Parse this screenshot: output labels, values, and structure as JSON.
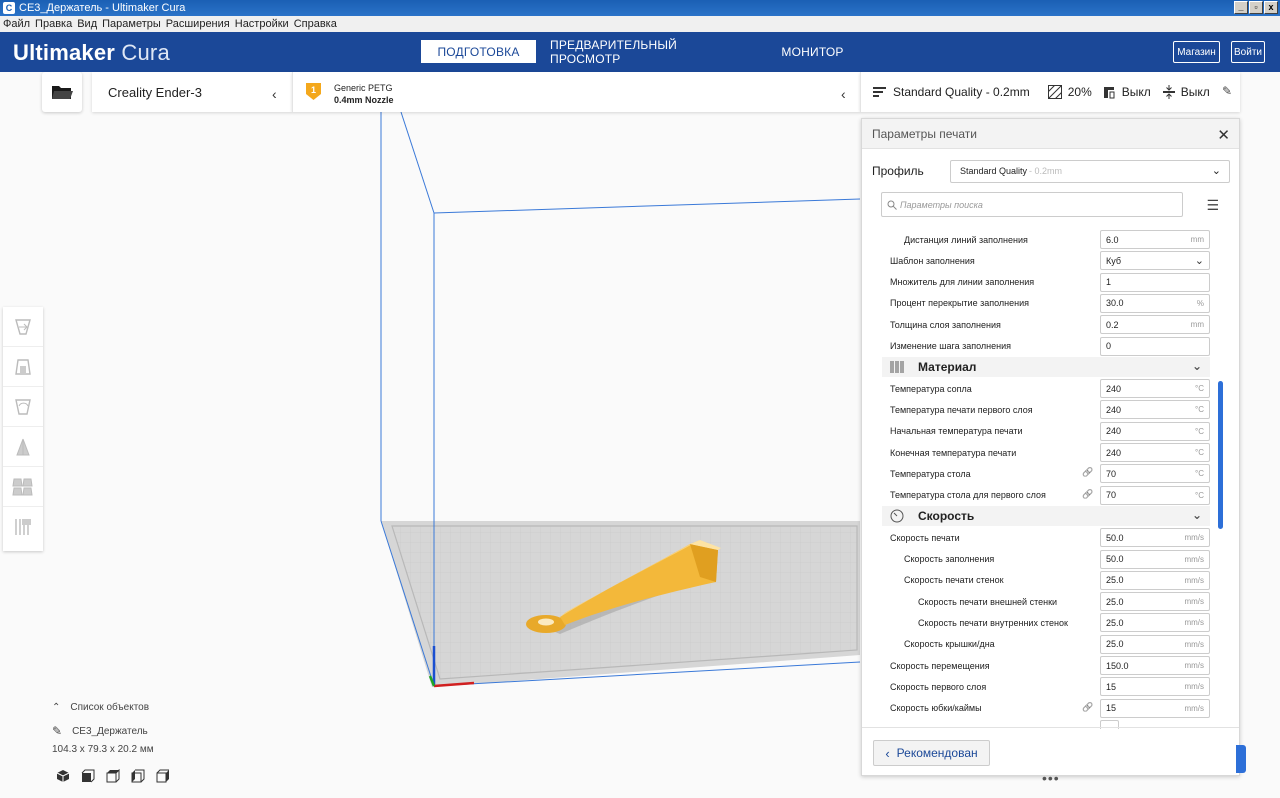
{
  "window": {
    "title": "CE3_Держатель - Ultimaker Cura",
    "app_icon": "C",
    "controls": [
      "_",
      "▫",
      "x"
    ]
  },
  "menu": [
    "Файл",
    "Правка",
    "Вид",
    "Параметры",
    "Расширения",
    "Настройки",
    "Справка"
  ],
  "header": {
    "logo_bold": "Ultimaker",
    "logo_light": "Cura",
    "tabs": [
      "ПОДГОТОВКА",
      "ПРЕДВАРИТЕЛЬНЫЙ ПРОСМОТР",
      "МОНИТОР"
    ],
    "active_tab": "ПОДГОТОВКА",
    "marketplace": "Магазин",
    "signin": "Войти"
  },
  "printer": {
    "name": "Creality Ender-3",
    "material_badge": "1",
    "material": "Generic PETG",
    "nozzle": "0.4mm Nozzle"
  },
  "quality_bar": {
    "profile": "Standard Quality - 0.2mm",
    "infill": "20%",
    "support": "Выкл",
    "adhesion": "Выкл"
  },
  "objects": {
    "header": "Список объектов",
    "name": "CE3_Держатель",
    "dims": "104.3 x 79.3 x 20.2 мм"
  },
  "panel": {
    "title": "Параметры печати",
    "profile_label": "Профиль",
    "profile_value": "Standard Quality",
    "profile_suffix": "- 0.2mm",
    "search_placeholder": "Параметры поиска",
    "recommended": "Рекомендован",
    "settings": [
      {
        "label": "Дистанция линий заполнения",
        "value": "6.0",
        "unit": "mm",
        "indent": 1
      },
      {
        "label": "Шаблон заполнения",
        "value": "Куб",
        "unit": "",
        "indent": 0,
        "dropdown": true
      },
      {
        "label": "Множитель для линии заполнения",
        "value": "1",
        "unit": "",
        "indent": 0
      },
      {
        "label": "Процент перекрытие заполнения",
        "value": "30.0",
        "unit": "%",
        "indent": 0
      },
      {
        "label": "Толщина слоя заполнения",
        "value": "0.2",
        "unit": "mm",
        "indent": 0
      },
      {
        "label": "Изменение шага заполнения",
        "value": "0",
        "unit": "",
        "indent": 0
      }
    ],
    "category_material": "Материал",
    "material_settings": [
      {
        "label": "Температура сопла",
        "value": "240",
        "unit": "°C",
        "link": false
      },
      {
        "label": "Температура печати первого слоя",
        "value": "240",
        "unit": "°C",
        "link": false
      },
      {
        "label": "Начальная температура печати",
        "value": "240",
        "unit": "°C",
        "link": false
      },
      {
        "label": "Конечная температура печати",
        "value": "240",
        "unit": "°C",
        "link": false
      },
      {
        "label": "Температура стола",
        "value": "70",
        "unit": "°C",
        "link": true
      },
      {
        "label": "Температура стола для первого слоя",
        "value": "70",
        "unit": "°C",
        "link": true
      }
    ],
    "category_speed": "Скорость",
    "speed_settings": [
      {
        "label": "Скорость печати",
        "value": "50.0",
        "unit": "mm/s",
        "indent": 0,
        "link": false
      },
      {
        "label": "Скорость заполнения",
        "value": "50.0",
        "unit": "mm/s",
        "indent": 1,
        "link": false
      },
      {
        "label": "Скорость печати стенок",
        "value": "25.0",
        "unit": "mm/s",
        "indent": 1,
        "link": false
      },
      {
        "label": "Скорость печати внешней стенки",
        "value": "25.0",
        "unit": "mm/s",
        "indent": 2,
        "link": false
      },
      {
        "label": "Скорость печати внутренних стенок",
        "value": "25.0",
        "unit": "mm/s",
        "indent": 2,
        "link": false
      },
      {
        "label": "Скорость крышки/дна",
        "value": "25.0",
        "unit": "mm/s",
        "indent": 1,
        "link": false
      },
      {
        "label": "Скорость перемещения",
        "value": "150.0",
        "unit": "mm/s",
        "indent": 0,
        "link": false
      },
      {
        "label": "Скорость первого слоя",
        "value": "15",
        "unit": "mm/s",
        "indent": 0,
        "link": false
      },
      {
        "label": "Скорость юбки/каймы",
        "value": "15",
        "unit": "mm/s",
        "indent": 0,
        "link": true
      }
    ]
  },
  "colors": {
    "brand": "#1b4898",
    "accent": "#2d6fd8",
    "model": "#f3b83a",
    "build_volume": "#3a79d8"
  }
}
